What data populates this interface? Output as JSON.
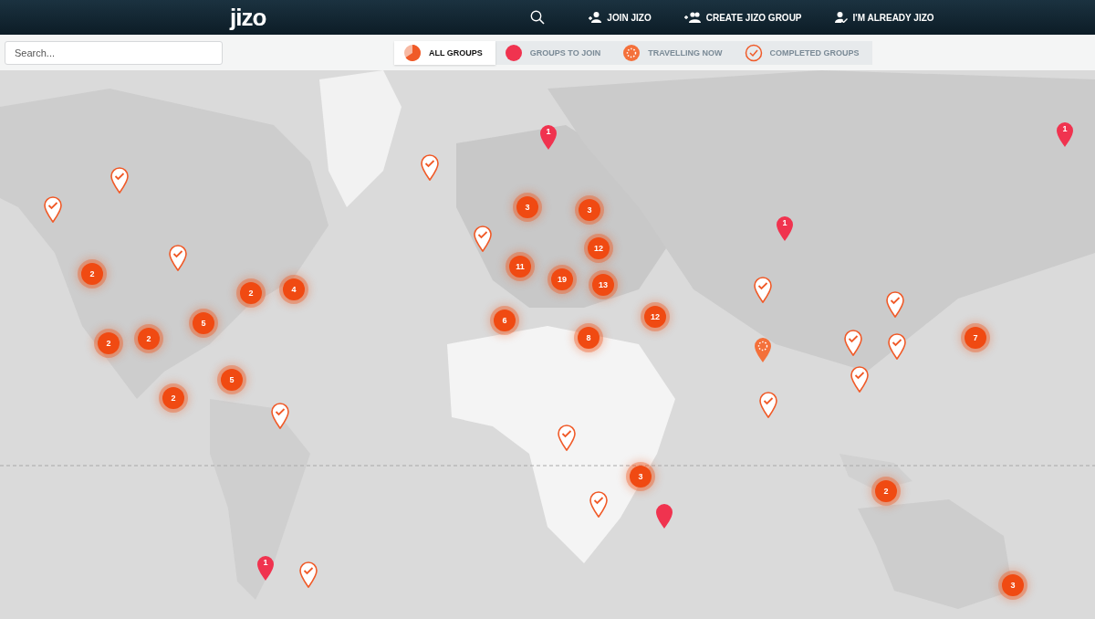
{
  "header": {
    "logo": "jizo",
    "nav": [
      {
        "label": "JOIN JIZO",
        "kind": "join"
      },
      {
        "label": "CREATE JIZO GROUP",
        "kind": "create"
      },
      {
        "label": "I'M ALREADY JIZO",
        "kind": "member"
      }
    ]
  },
  "search": {
    "placeholder": "Search..."
  },
  "filters": [
    {
      "label": "ALL GROUPS",
      "kind": "all",
      "selected": true
    },
    {
      "label": "GROUPS TO JOIN",
      "kind": "join",
      "selected": false
    },
    {
      "label": "TRAVELLING NOW",
      "kind": "travelling",
      "selected": false
    },
    {
      "label": "COMPLETED GROUPS",
      "kind": "completed",
      "selected": false
    }
  ],
  "map": {
    "kind": "picture",
    "markers": [
      {
        "kind": "cluster",
        "label": "2"
      },
      {
        "kind": "cluster",
        "label": "2"
      },
      {
        "kind": "cluster",
        "label": "2"
      },
      {
        "kind": "cluster",
        "label": "5"
      },
      {
        "kind": "cluster",
        "label": "2"
      },
      {
        "kind": "cluster",
        "label": "4"
      },
      {
        "kind": "cluster",
        "label": "5"
      },
      {
        "kind": "cluster",
        "label": "2"
      },
      {
        "kind": "cluster",
        "label": "3"
      },
      {
        "kind": "cluster",
        "label": "3"
      },
      {
        "kind": "cluster",
        "label": "12"
      },
      {
        "kind": "cluster",
        "label": "11"
      },
      {
        "kind": "cluster",
        "label": "19"
      },
      {
        "kind": "cluster",
        "label": "13"
      },
      {
        "kind": "cluster",
        "label": "6"
      },
      {
        "kind": "cluster",
        "label": "12"
      },
      {
        "kind": "cluster",
        "label": "8"
      },
      {
        "kind": "cluster",
        "label": "3"
      },
      {
        "kind": "cluster",
        "label": "7"
      },
      {
        "kind": "cluster",
        "label": "2"
      },
      {
        "kind": "cluster",
        "label": "3"
      },
      {
        "kind": "join",
        "label": "1"
      },
      {
        "kind": "join",
        "label": "1"
      },
      {
        "kind": "join",
        "label": "1"
      },
      {
        "kind": "join",
        "label": "1"
      },
      {
        "kind": "join"
      },
      {
        "kind": "completed"
      },
      {
        "kind": "completed"
      },
      {
        "kind": "completed"
      },
      {
        "kind": "completed"
      },
      {
        "kind": "completed"
      },
      {
        "kind": "completed"
      },
      {
        "kind": "completed"
      },
      {
        "kind": "completed"
      },
      {
        "kind": "completed"
      },
      {
        "kind": "completed"
      },
      {
        "kind": "completed"
      },
      {
        "kind": "completed"
      },
      {
        "kind": "completed"
      },
      {
        "kind": "completed"
      },
      {
        "kind": "completed"
      },
      {
        "kind": "travelling"
      }
    ]
  }
}
